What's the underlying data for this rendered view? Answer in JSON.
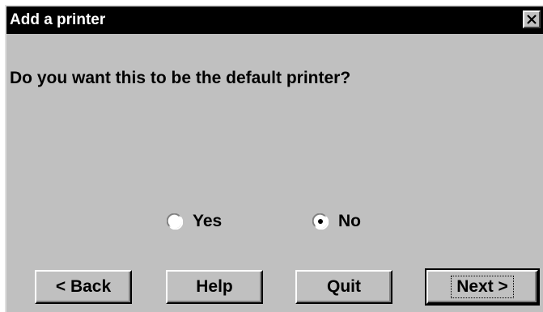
{
  "window": {
    "title": "Add a printer"
  },
  "prompt": {
    "question": "Do you want this to be the default printer?"
  },
  "options": {
    "yes_label": "Yes",
    "no_label": "No",
    "selected": "No"
  },
  "buttons": {
    "back_label": "< Back",
    "help_label": "Help",
    "quit_label": "Quit",
    "next_label": "Next >"
  },
  "icons": {
    "close": "close-icon",
    "radio_unselected": "radio-unselected-icon",
    "radio_selected": "radio-selected-icon"
  },
  "colors": {
    "titlebar": "#000000",
    "title_text": "#ffffff",
    "dialog_background": "#c0c0c0"
  }
}
